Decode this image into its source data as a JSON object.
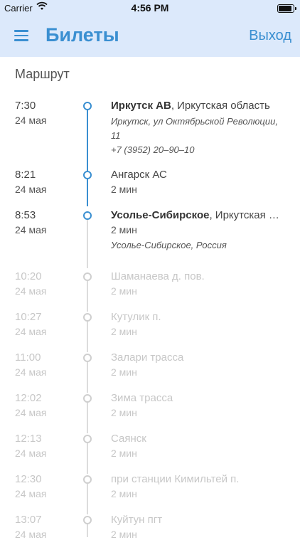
{
  "status_bar": {
    "carrier": "Carrier",
    "time": "4:56 PM"
  },
  "nav": {
    "title": "Билеты",
    "logout": "Выход"
  },
  "section_title": "Маршрут",
  "stops": [
    {
      "time": "7:30",
      "date": "24 мая",
      "name_bold": "Иркутск АВ",
      "name_rest": ", Иркутская область",
      "address_line1": "Иркутск, ул Октябрьской Революции,",
      "address_line2": "11",
      "phone": "+7 (3952) 20–90–10"
    },
    {
      "time": "8:21",
      "date": "24 мая",
      "name": "Ангарск АС",
      "duration": "2 мин"
    },
    {
      "time": "8:53",
      "date": "24 мая",
      "name_bold": "Усолье-Сибирское",
      "name_rest": ", Иркутская о…",
      "duration": "2 мин",
      "address": "Усолье-Сибирское, Россия"
    },
    {
      "time": "10:20",
      "date": "24 мая",
      "name": "Шаманаева д. пов.",
      "duration": "2 мин"
    },
    {
      "time": "10:27",
      "date": "24 мая",
      "name": "Кутулик п.",
      "duration": "2 мин"
    },
    {
      "time": "11:00",
      "date": "24 мая",
      "name": "Залари трасса",
      "duration": "2 мин"
    },
    {
      "time": "12:02",
      "date": "24 мая",
      "name": "Зима трасса",
      "duration": "2 мин"
    },
    {
      "time": "12:13",
      "date": "24 мая",
      "name": "Саянск",
      "duration": "2 мин"
    },
    {
      "time": "12:30",
      "date": "24 мая",
      "name": "при станции Кимильтей п.",
      "duration": "2 мин"
    },
    {
      "time": "13:07",
      "date": "24 мая",
      "name": "Куйтун пгт",
      "duration": "2 мин"
    }
  ],
  "colors": {
    "accent": "#3a8fd1",
    "header_bg": "#dce9fb",
    "inactive": "#c7c7c7"
  }
}
